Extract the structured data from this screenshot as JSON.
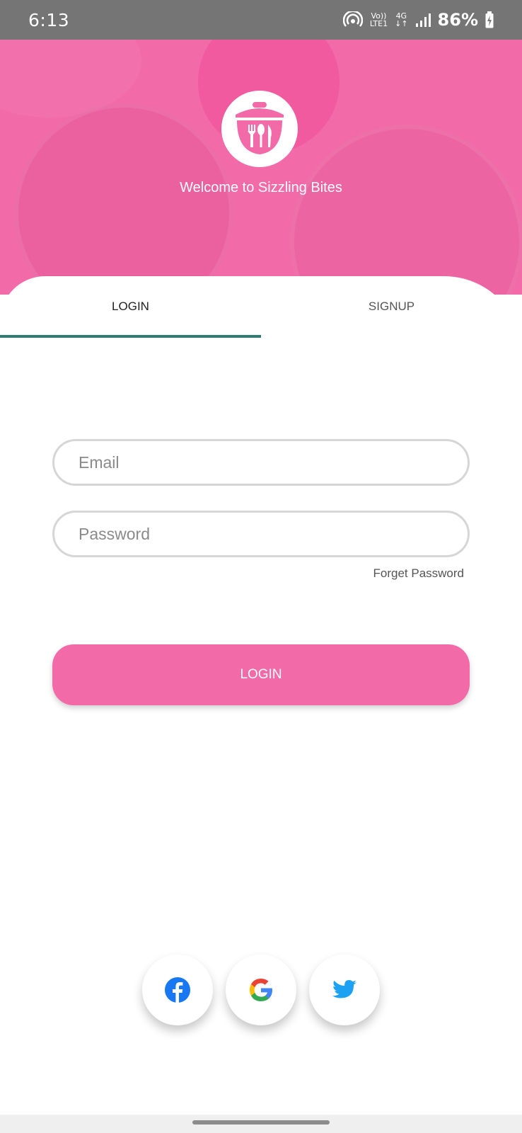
{
  "status_bar": {
    "time": "6:13",
    "volte_label": "Vo))",
    "lte_label": "LTE1",
    "network_label": "4G",
    "battery": "86%"
  },
  "header": {
    "welcome": "Welcome to Sizzling Bites",
    "brand_color": "#f26aa8"
  },
  "tabs": {
    "login_label": "LOGIN",
    "signup_label": "SIGNUP",
    "active": "LOGIN",
    "indicator_color": "#2e7d73"
  },
  "form": {
    "email_placeholder": "Email",
    "email_value": "",
    "password_placeholder": "Password",
    "password_value": "",
    "forgot_label": "Forget Password",
    "login_button_label": "LOGIN"
  },
  "social": {
    "items": [
      {
        "icon": "facebook-icon",
        "color": "#1877f2"
      },
      {
        "icon": "google-icon",
        "color": "#4285f4"
      },
      {
        "icon": "twitter-icon",
        "color": "#1da1f2"
      }
    ]
  }
}
